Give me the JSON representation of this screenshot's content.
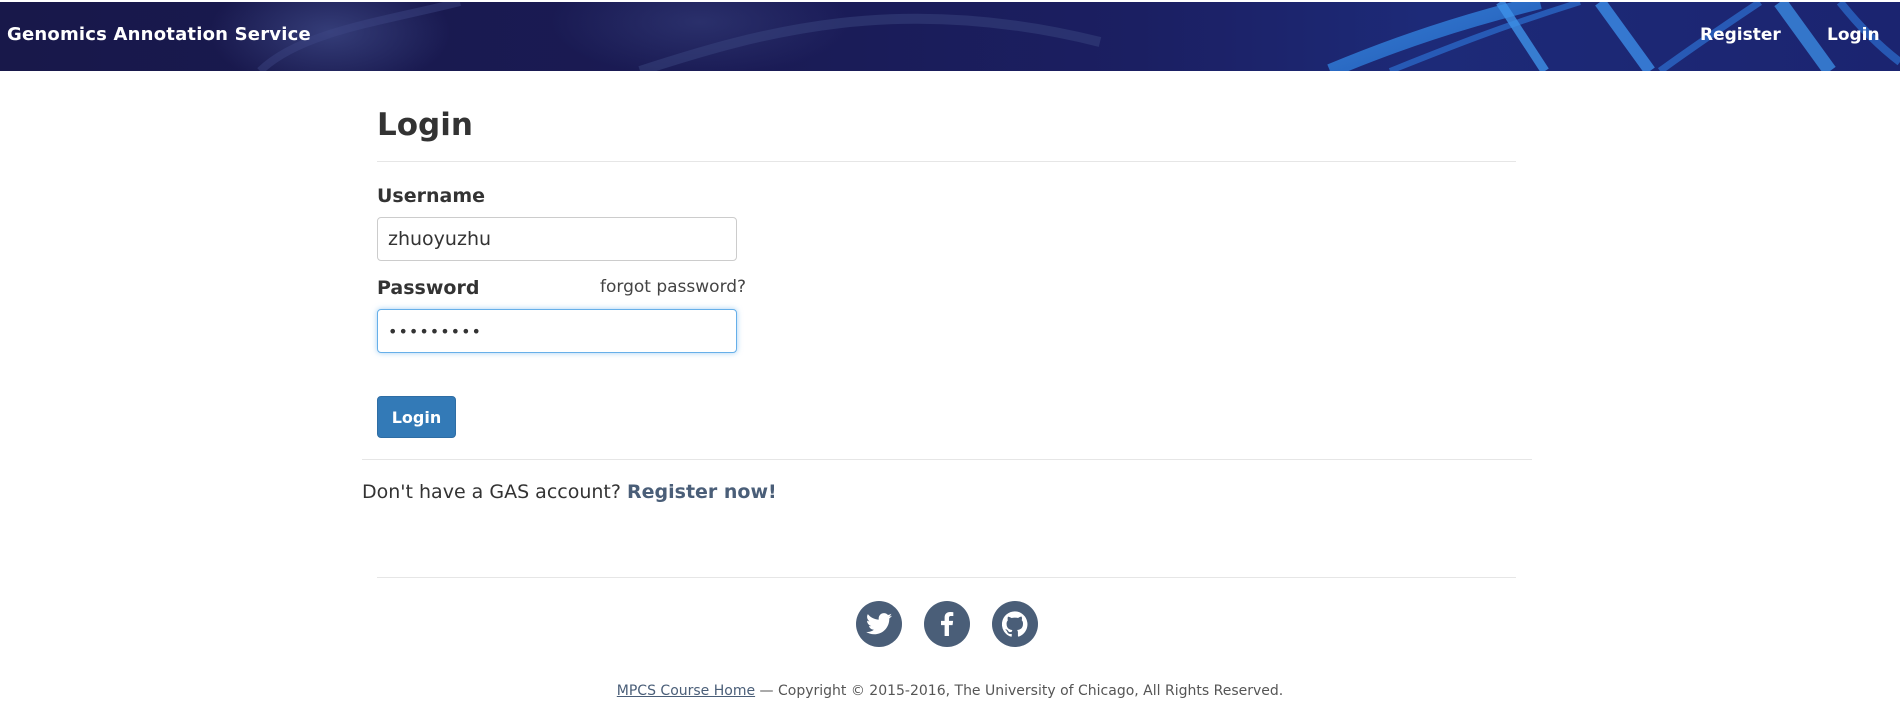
{
  "navbar": {
    "brand": "Genomics Annotation Service",
    "links": {
      "register": "Register",
      "login": "Login"
    }
  },
  "login_form": {
    "title": "Login",
    "username_label": "Username",
    "username_value": "zhuoyuzhu",
    "password_label": "Password",
    "forgot_password": "forgot password?",
    "password_value": "•••••••••",
    "submit_label": "Login"
  },
  "register_prompt": {
    "text": "Don't have a GAS account? ",
    "link": "Register now!"
  },
  "footer": {
    "social_icons": [
      "twitter-icon",
      "facebook-icon",
      "github-icon"
    ],
    "course_link": "MPCS Course Home",
    "copyright": " — Copyright © 2015-2016, The University of Chicago, All Rights Reserved."
  },
  "colors": {
    "primary_button": "#337ab7",
    "accent_link": "#4a5e78",
    "navbar_background": "#1a1b55",
    "focus_border": "#66afe9"
  }
}
